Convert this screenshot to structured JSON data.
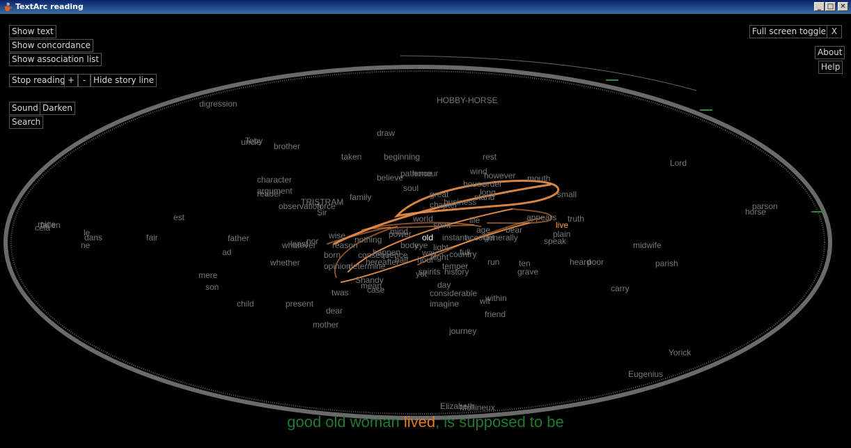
{
  "window": {
    "title": "TextArc reading",
    "min_glyph": "_",
    "max_glyph": "□",
    "close_glyph": "✕"
  },
  "buttons": {
    "show_text": "Show text",
    "show_concordance": "Show concordance",
    "show_association_list": "Show association list",
    "stop_reading": "Stop reading",
    "plus": "+",
    "minus": "-",
    "hide_story_line": "Hide story line",
    "sound": "Sound",
    "darken": "Darken",
    "search": "Search",
    "full_screen_toggle": "Full screen toggle",
    "exit": "X",
    "about": "About",
    "help": "Help"
  },
  "words": [
    "HOBBY-HORSE",
    "digression",
    "draw",
    "Toby",
    "uncle",
    "brother",
    "taken",
    "beginning",
    "rest",
    "Lord",
    "parson",
    "horse",
    "believe",
    "patience",
    "honour",
    "wind",
    "however",
    "mouth",
    "character",
    "argument",
    "reader",
    "soul",
    "house",
    "order",
    "small",
    "great",
    "long",
    "stand",
    "TRISTRAM",
    "family",
    "observation",
    "force",
    "business",
    "chapter",
    "Sir",
    "est",
    "truth",
    "appears",
    "live",
    "plain",
    "speak",
    "bear",
    "generally",
    "account",
    "instant",
    "world",
    "spirit",
    "old",
    "age",
    "fair",
    "dans",
    "le",
    "ne",
    "father",
    "nor",
    "least",
    "wise",
    "whatever",
    "reason",
    "ad",
    "cela",
    "mine",
    "fallen",
    "midwife",
    "heard",
    "poor",
    "parish",
    "ten",
    "grave",
    "run",
    "way",
    "life",
    "born",
    "consequence",
    "happen",
    "whether",
    "hereafter",
    "half",
    "eye",
    "hour",
    "night",
    "country",
    "full",
    "temper",
    "history",
    "opinion",
    "determine",
    "mere",
    "Shandy",
    "spirits",
    "mean",
    "case",
    "son",
    "day",
    "considerable",
    "carry",
    "twas",
    "child",
    "present",
    "within",
    "wit",
    "imagine",
    "dear",
    "friend",
    "mother",
    "journey",
    "Yorick",
    "Eugenius",
    "Elizabeth",
    "Mollineux",
    "light",
    "body",
    "nothing",
    "power",
    "yet",
    "mind"
  ],
  "reading": {
    "before": "good old woman ",
    "current": "lived",
    "after": ", is supposed to be"
  },
  "colors": {
    "before": "#1f7a2e",
    "current": "#e07a22",
    "after": "#1f7a2e",
    "storyline": "#f0924a",
    "ellipse": "#9a9a9a"
  }
}
